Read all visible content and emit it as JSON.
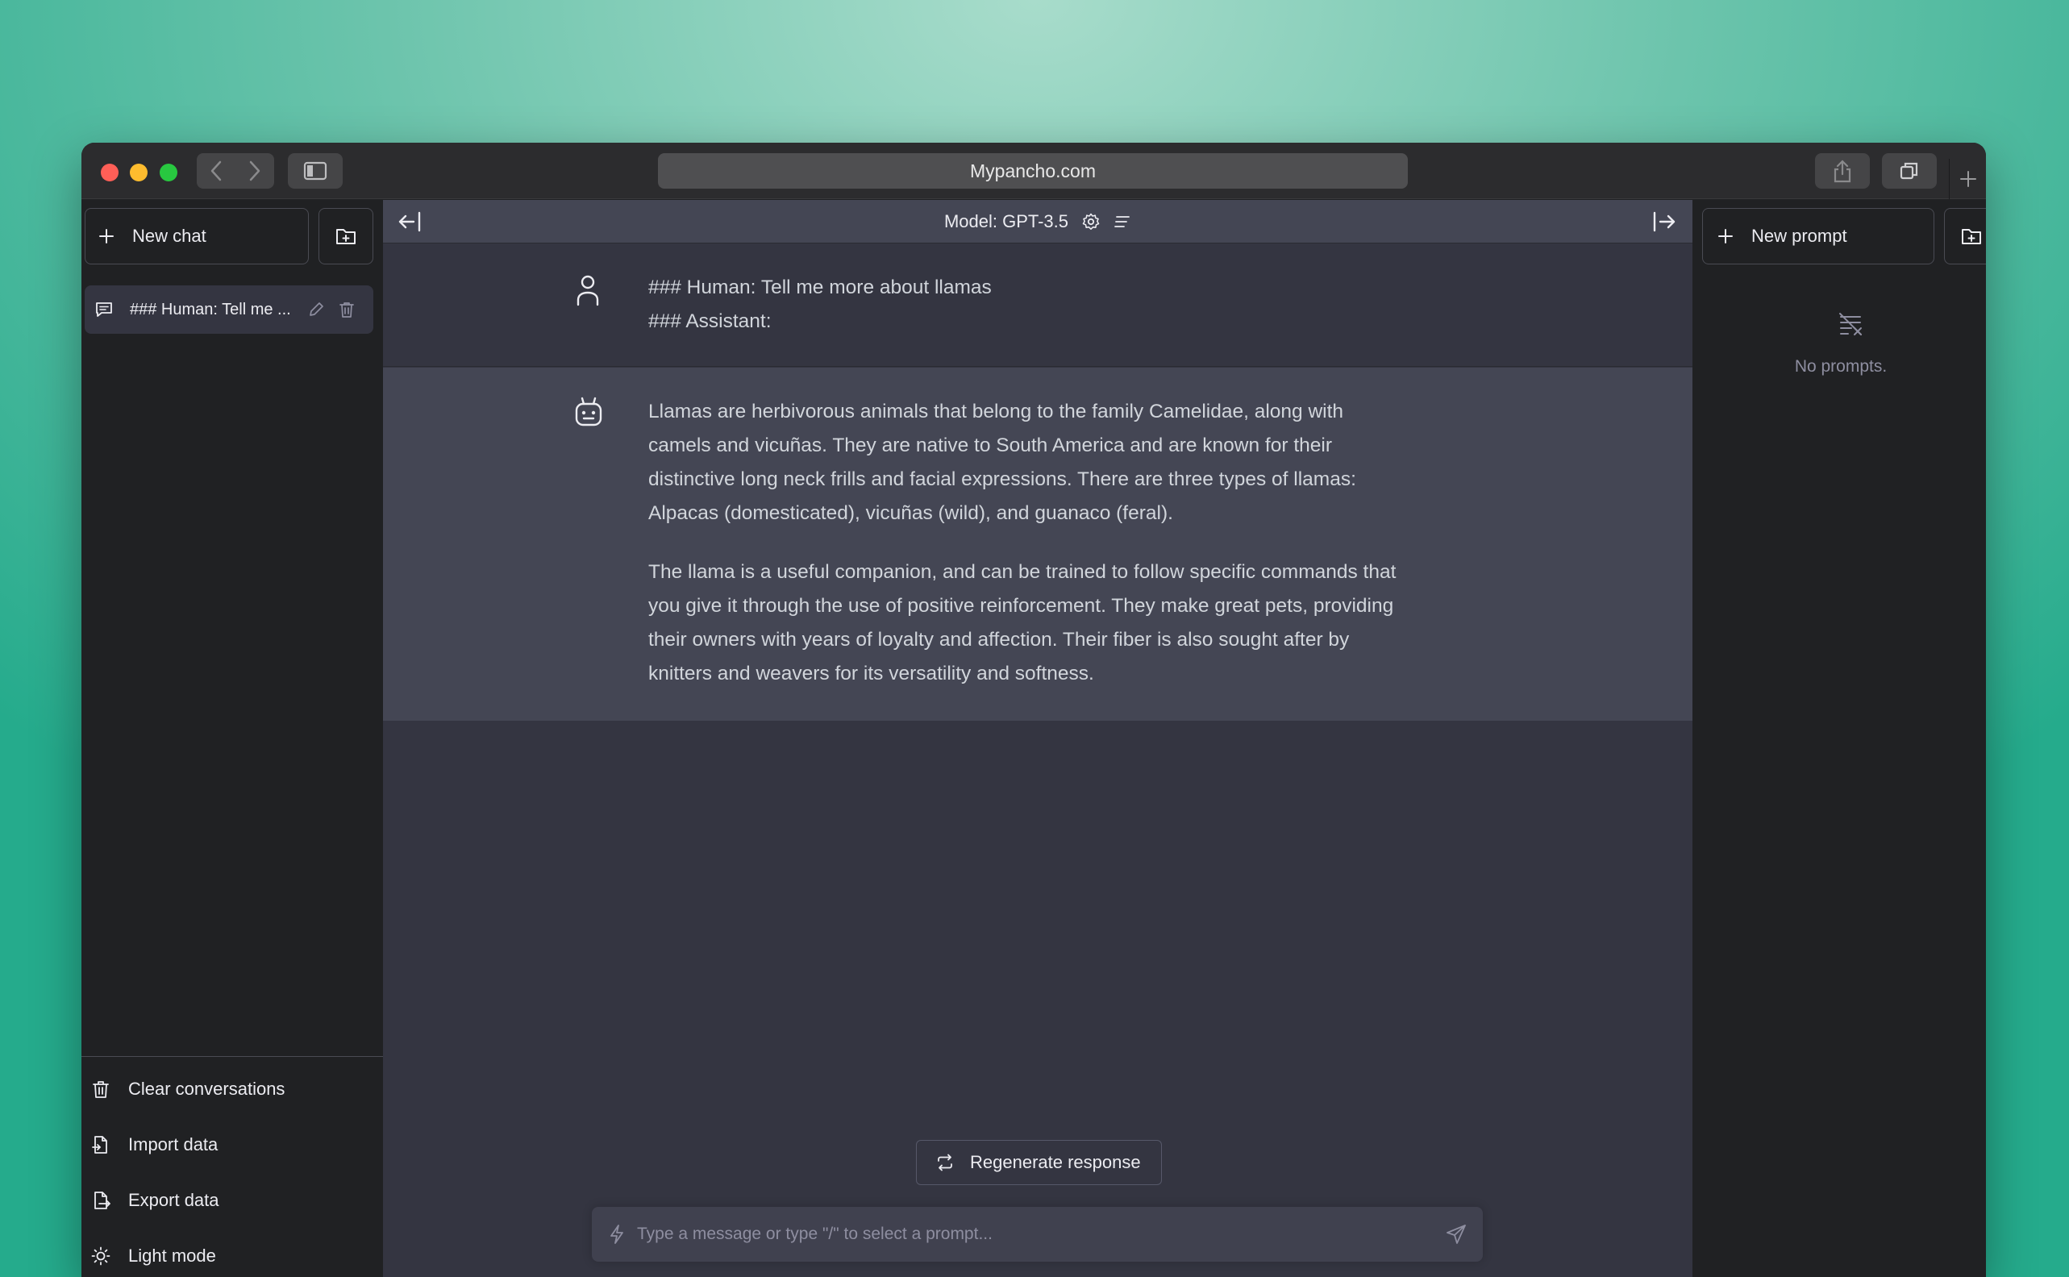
{
  "browser": {
    "url": "Mypancho.com"
  },
  "left_sidebar": {
    "new_chat_label": "New chat",
    "conversations": [
      {
        "title": "### Human: Tell me ..."
      }
    ],
    "menu": {
      "clear": "Clear conversations",
      "import": "Import data",
      "export": "Export data",
      "theme": "Light mode"
    }
  },
  "main": {
    "model_label": "Model: GPT-3.5",
    "messages": {
      "user_line1": "### Human: Tell me more about llamas",
      "user_line2": "### Assistant:",
      "bot_p1_l1": "Llamas are herbivorous animals that belong to the family Camelidae, along with",
      "bot_p1_l2": "camels and vicuñas. They are native to South America and are known for their",
      "bot_p1_l3": "distinctive long neck frills and facial expressions. There are three types of llamas:",
      "bot_p1_l4": "Alpacas (domesticated), vicuñas (wild), and guanaco (feral).",
      "bot_p2_l1": "The llama is a useful companion, and can be trained to follow specific commands that",
      "bot_p2_l2": "you give it through the use of positive reinforcement. They make great pets, providing",
      "bot_p2_l3": "their owners with years of loyalty and affection. Their fiber is also sought after by",
      "bot_p2_l4": "knitters and weavers for its versatility and softness."
    },
    "regenerate_label": "Regenerate response",
    "input_placeholder": "Type a message or type \"/\" to select a prompt..."
  },
  "right_sidebar": {
    "new_prompt_label": "New prompt",
    "empty_text": "No prompts."
  }
}
